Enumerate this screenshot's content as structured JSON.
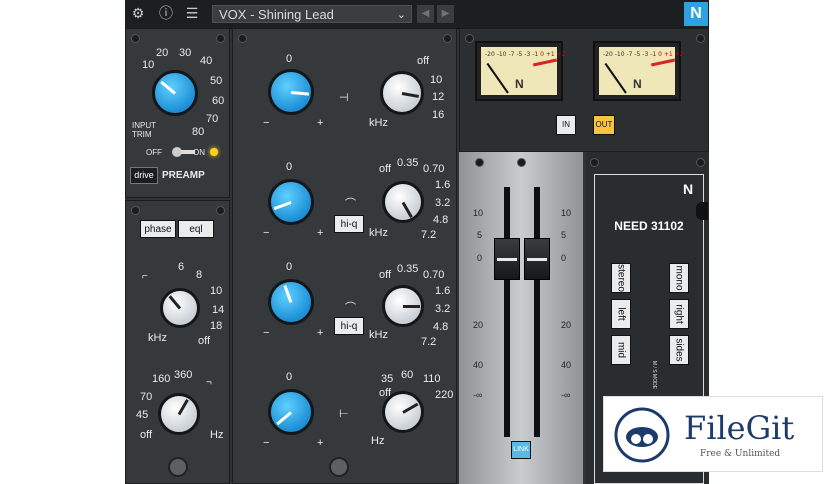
{
  "topbar": {
    "settings_icon": "gear-icon",
    "info_icon": "info-icon",
    "mixer_icon": "sliders-icon",
    "preset_name": "VOX - Shining Lead",
    "prev_icon": "chevron-left-icon",
    "next_icon": "chevron-right-icon",
    "logo": "N"
  },
  "preamp": {
    "scale": [
      "10",
      "20",
      "30",
      "40",
      "50",
      "60",
      "70",
      "80"
    ],
    "input_trim_label": "INPUT\nTRIM",
    "off_label": "OFF",
    "on_label": "ON",
    "drive_label": "drive",
    "preamp_label": "PREAMP",
    "led_color": "#ffd21f"
  },
  "filters": {
    "phase_label": "phase",
    "eql_label": "eql",
    "hpf_scale": [
      "6",
      "8",
      "10",
      "14",
      "18",
      "off"
    ],
    "hpf_unit": "kHz",
    "lpf_scale": [
      "160",
      "360",
      "70",
      "45",
      "off"
    ],
    "lpf_unit": "Hz"
  },
  "eq": {
    "band1": {
      "gain_zero": "0",
      "minus": "−",
      "plus": "+",
      "freq_scale": [
        "off",
        "10",
        "12",
        "16"
      ],
      "unit": "kHz"
    },
    "band2": {
      "gain_zero": "0",
      "minus": "−",
      "plus": "+",
      "freq_scale": [
        "off",
        "0.35",
        "0.70",
        "1.6",
        "3.2",
        "4.8",
        "7.2"
      ],
      "unit": "kHz",
      "hiq_label": "hi-q"
    },
    "band3": {
      "gain_zero": "0",
      "minus": "−",
      "plus": "+",
      "freq_scale": [
        "off",
        "0.35",
        "0.70",
        "1.6",
        "3.2",
        "4.8",
        "7.2"
      ],
      "unit": "kHz",
      "hiq_label": "hi-q"
    },
    "band4": {
      "gain_zero": "0",
      "minus": "−",
      "plus": "+",
      "freq_scale": [
        "off",
        "35",
        "60",
        "110",
        "220"
      ],
      "unit": "Hz"
    }
  },
  "meters": {
    "scale": [
      "-20",
      "-10",
      "-7",
      "-5",
      "-3",
      "-1",
      "0",
      "+1",
      "+2"
    ],
    "in_label": "IN",
    "out_label": "OUT",
    "meter_logo": "N"
  },
  "faders": {
    "scale_left": [
      "10",
      "5",
      "0",
      "20",
      "40",
      "-∞"
    ],
    "scale_right": [
      "10",
      "5",
      "0",
      "20",
      "40",
      "-∞"
    ],
    "link_label": "LINK"
  },
  "need": {
    "logo": "N",
    "title": "NEED 31102",
    "left_buttons": [
      "stereo",
      "left",
      "mid"
    ],
    "right_buttons": [
      "mono",
      "right",
      "sides"
    ],
    "ms_mode_label": "M / S MODE"
  },
  "watermark": {
    "brand": "FileGit",
    "tagline": "Free & Unlimited"
  }
}
